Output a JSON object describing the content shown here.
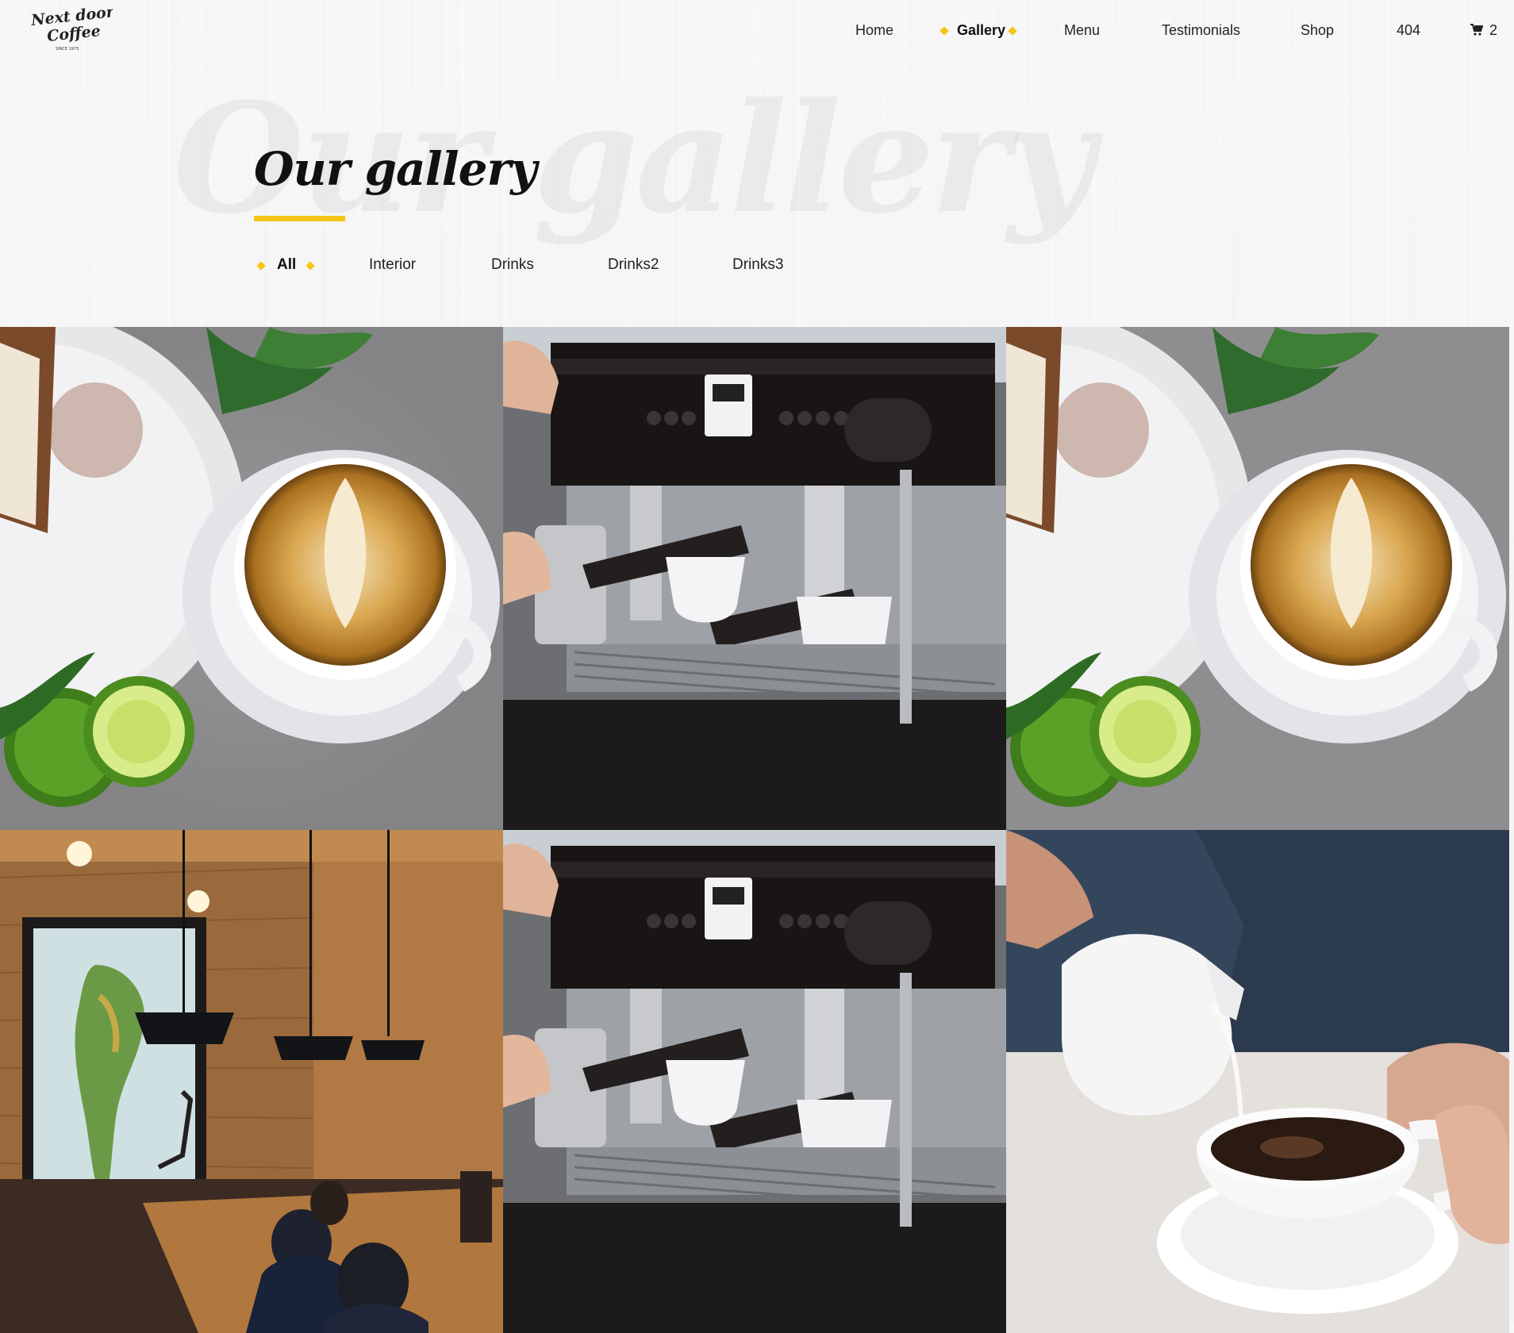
{
  "logo": {
    "line1": "Next door",
    "line2": "Coffee",
    "tagline": "SINCE 1973"
  },
  "nav": {
    "items": [
      {
        "label": "Home",
        "active": false
      },
      {
        "label": "Gallery",
        "active": true
      },
      {
        "label": "Menu",
        "active": false
      },
      {
        "label": "Testimonials",
        "active": false
      },
      {
        "label": "Shop",
        "active": false
      },
      {
        "label": "404",
        "active": false
      }
    ],
    "cart_count": "2",
    "cart_icon": "shopping-cart-icon"
  },
  "hero": {
    "title": "Our gallery",
    "background_word": "Our gallery"
  },
  "filters": [
    {
      "label": "All",
      "active": true
    },
    {
      "label": "Interior",
      "active": false
    },
    {
      "label": "Drinks",
      "active": false
    },
    {
      "label": "Drinks2",
      "active": false
    },
    {
      "label": "Drinks3",
      "active": false
    }
  ],
  "gallery": {
    "images": [
      {
        "subject": "latte-art-with-limes"
      },
      {
        "subject": "espresso-machine"
      },
      {
        "subject": "latte-art-with-limes"
      },
      {
        "subject": "cafe-interior-with-map"
      },
      {
        "subject": "espresso-machine"
      },
      {
        "subject": "milk-pour-into-coffee"
      }
    ]
  },
  "colors": {
    "accent": "#f5c518",
    "text": "#111111",
    "background": "#f6f6f6"
  }
}
